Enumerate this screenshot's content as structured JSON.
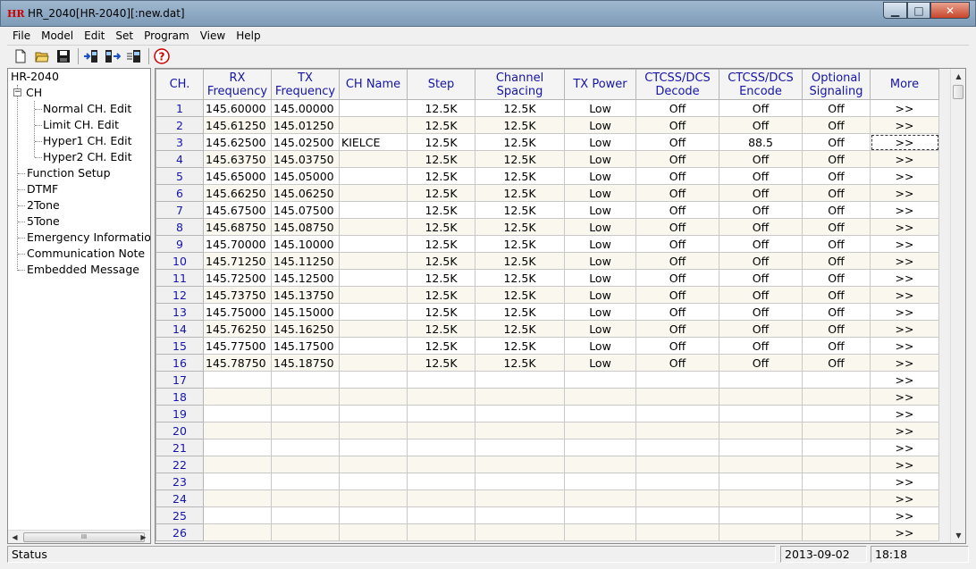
{
  "window": {
    "title": "HR_2040[HR-2040][:new.dat]",
    "icon": "app-logo-icon"
  },
  "window_controls": {
    "minimize": "▁",
    "maximize": "□",
    "close": "✕"
  },
  "menu": [
    "File",
    "Model",
    "Edit",
    "Set",
    "Program",
    "View",
    "Help"
  ],
  "toolbar": [
    "new-file-icon",
    "open-folder-icon",
    "save-disk-icon",
    "read-radio-icon",
    "write-radio-icon",
    "radio-info-icon",
    "help-icon"
  ],
  "tree": {
    "root": "HR-2040",
    "ch": "CH",
    "ch_children": [
      "Normal CH. Edit",
      "Limit CH. Edit",
      "Hyper1 CH. Edit",
      "Hyper2 CH. Edit"
    ],
    "others": [
      "Function Setup",
      "DTMF",
      "2Tone",
      "5Tone",
      "Emergency Informatio",
      "Communication Note",
      "Embedded Message"
    ],
    "hscroll_grip": "III"
  },
  "grid": {
    "headers": [
      "CH.",
      "RX\nFrequency",
      "TX\nFrequency",
      "CH Name",
      "Step",
      "Channel\nSpacing",
      "TX Power",
      "CTCSS/DCS\nDecode",
      "CTCSS/DCS\nEncode",
      "Optional\nSignaling",
      "More"
    ],
    "rows": [
      [
        "1",
        "145.60000",
        "145.00000",
        "",
        "12.5K",
        "12.5K",
        "Low",
        "Off",
        "Off",
        "Off",
        ">>"
      ],
      [
        "2",
        "145.61250",
        "145.01250",
        "",
        "12.5K",
        "12.5K",
        "Low",
        "Off",
        "Off",
        "Off",
        ">>"
      ],
      [
        "3",
        "145.62500",
        "145.02500",
        "KIELCE",
        "12.5K",
        "12.5K",
        "Low",
        "Off",
        "88.5",
        "Off",
        ">>"
      ],
      [
        "4",
        "145.63750",
        "145.03750",
        "",
        "12.5K",
        "12.5K",
        "Low",
        "Off",
        "Off",
        "Off",
        ">>"
      ],
      [
        "5",
        "145.65000",
        "145.05000",
        "",
        "12.5K",
        "12.5K",
        "Low",
        "Off",
        "Off",
        "Off",
        ">>"
      ],
      [
        "6",
        "145.66250",
        "145.06250",
        "",
        "12.5K",
        "12.5K",
        "Low",
        "Off",
        "Off",
        "Off",
        ">>"
      ],
      [
        "7",
        "145.67500",
        "145.07500",
        "",
        "12.5K",
        "12.5K",
        "Low",
        "Off",
        "Off",
        "Off",
        ">>"
      ],
      [
        "8",
        "145.68750",
        "145.08750",
        "",
        "12.5K",
        "12.5K",
        "Low",
        "Off",
        "Off",
        "Off",
        ">>"
      ],
      [
        "9",
        "145.70000",
        "145.10000",
        "",
        "12.5K",
        "12.5K",
        "Low",
        "Off",
        "Off",
        "Off",
        ">>"
      ],
      [
        "10",
        "145.71250",
        "145.11250",
        "",
        "12.5K",
        "12.5K",
        "Low",
        "Off",
        "Off",
        "Off",
        ">>"
      ],
      [
        "11",
        "145.72500",
        "145.12500",
        "",
        "12.5K",
        "12.5K",
        "Low",
        "Off",
        "Off",
        "Off",
        ">>"
      ],
      [
        "12",
        "145.73750",
        "145.13750",
        "",
        "12.5K",
        "12.5K",
        "Low",
        "Off",
        "Off",
        "Off",
        ">>"
      ],
      [
        "13",
        "145.75000",
        "145.15000",
        "",
        "12.5K",
        "12.5K",
        "Low",
        "Off",
        "Off",
        "Off",
        ">>"
      ],
      [
        "14",
        "145.76250",
        "145.16250",
        "",
        "12.5K",
        "12.5K",
        "Low",
        "Off",
        "Off",
        "Off",
        ">>"
      ],
      [
        "15",
        "145.77500",
        "145.17500",
        "",
        "12.5K",
        "12.5K",
        "Low",
        "Off",
        "Off",
        "Off",
        ">>"
      ],
      [
        "16",
        "145.78750",
        "145.18750",
        "",
        "12.5K",
        "12.5K",
        "Low",
        "Off",
        "Off",
        "Off",
        ">>"
      ],
      [
        "17",
        "",
        "",
        "",
        "",
        "",
        "",
        "",
        "",
        "",
        ">>"
      ],
      [
        "18",
        "",
        "",
        "",
        "",
        "",
        "",
        "",
        "",
        "",
        ">>"
      ],
      [
        "19",
        "",
        "",
        "",
        "",
        "",
        "",
        "",
        "",
        "",
        ">>"
      ],
      [
        "20",
        "",
        "",
        "",
        "",
        "",
        "",
        "",
        "",
        "",
        ">>"
      ],
      [
        "21",
        "",
        "",
        "",
        "",
        "",
        "",
        "",
        "",
        "",
        ">>"
      ],
      [
        "22",
        "",
        "",
        "",
        "",
        "",
        "",
        "",
        "",
        "",
        ">>"
      ],
      [
        "23",
        "",
        "",
        "",
        "",
        "",
        "",
        "",
        "",
        "",
        ">>"
      ],
      [
        "24",
        "",
        "",
        "",
        "",
        "",
        "",
        "",
        "",
        "",
        ">>"
      ],
      [
        "25",
        "",
        "",
        "",
        "",
        "",
        "",
        "",
        "",
        "",
        ">>"
      ],
      [
        "26",
        "",
        "",
        "",
        "",
        "",
        "",
        "",
        "",
        "",
        ">>"
      ]
    ],
    "focused_row": 3,
    "focused_col": 10
  },
  "status": {
    "text": "Status",
    "date": "2013-09-02",
    "time": "18:18"
  }
}
